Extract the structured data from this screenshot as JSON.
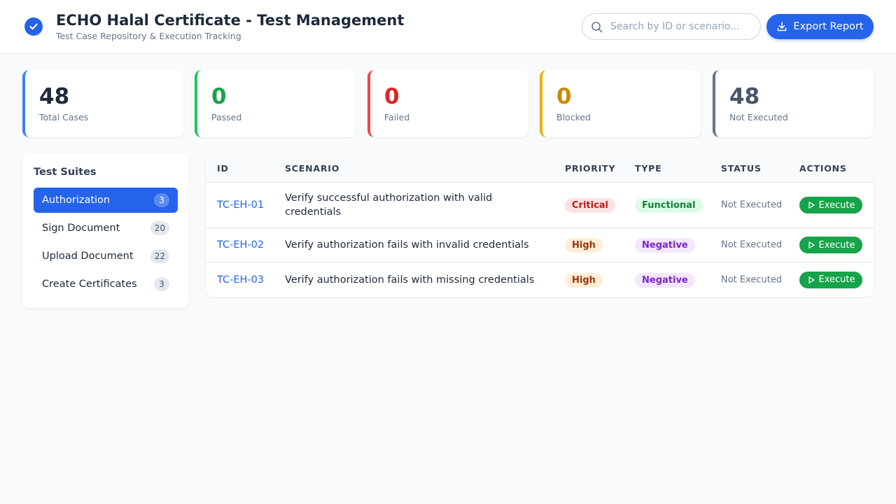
{
  "header": {
    "title": "ECHO Halal Certificate - Test Management",
    "subtitle": "Test Case Repository & Execution Tracking",
    "brand_icon": "check-circle-icon",
    "search_placeholder": "Search by ID or scenario...",
    "export_label": "Export Report",
    "accent_color": "#2563eb"
  },
  "stats": [
    {
      "value": "48",
      "label": "Total Cases",
      "color": "#3b82f6",
      "value_color": "#1e293b"
    },
    {
      "value": "0",
      "label": "Passed",
      "color": "#22c55e",
      "value_color": "#16a34a"
    },
    {
      "value": "0",
      "label": "Failed",
      "color": "#ef4444",
      "value_color": "#dc2626"
    },
    {
      "value": "0",
      "label": "Blocked",
      "color": "#eab308",
      "value_color": "#ca8a04"
    },
    {
      "value": "48",
      "label": "Not Executed",
      "color": "#64748b",
      "value_color": "#475569"
    }
  ],
  "suites": {
    "title": "Test Suites",
    "items": [
      {
        "label": "Authorization",
        "count": "3",
        "active": true
      },
      {
        "label": "Sign Document",
        "count": "20",
        "active": false
      },
      {
        "label": "Upload Document",
        "count": "22",
        "active": false
      },
      {
        "label": "Create Certificates",
        "count": "3",
        "active": false
      }
    ]
  },
  "table": {
    "columns": [
      "ID",
      "SCENARIO",
      "PRIORITY",
      "TYPE",
      "STATUS",
      "ACTIONS"
    ],
    "rows": [
      {
        "id": "TC-EH-01",
        "scenario": "Verify successful authorization with valid credentials",
        "priority": "Critical",
        "type": "Functional",
        "status": "Not Executed",
        "action": "Execute"
      },
      {
        "id": "TC-EH-02",
        "scenario": "Verify authorization fails with invalid credentials",
        "priority": "High",
        "type": "Negative",
        "status": "Not Executed",
        "action": "Execute"
      },
      {
        "id": "TC-EH-03",
        "scenario": "Verify authorization fails with missing credentials",
        "priority": "High",
        "type": "Negative",
        "status": "Not Executed",
        "action": "Execute"
      }
    ]
  },
  "badge_colors": {
    "Critical": {
      "bg": "#fee2e2",
      "fg": "#b91c1c"
    },
    "High": {
      "bg": "#ffedd5",
      "fg": "#9a3412"
    },
    "Functional": {
      "bg": "#dcfce7",
      "fg": "#15803d"
    },
    "Negative": {
      "bg": "#f3e8ff",
      "fg": "#7e22ce"
    }
  },
  "execute_color": "#16a34a"
}
